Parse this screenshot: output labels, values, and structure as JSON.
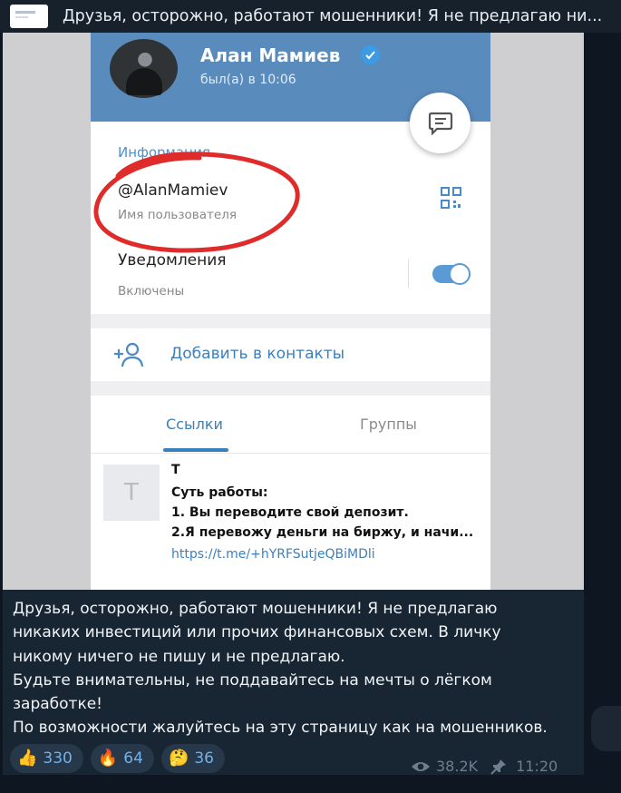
{
  "pinned": {
    "text": "Друзья, осторожно, работают мошенники! Я не предлагаю ни..."
  },
  "screenshot": {
    "profile_name": "Алан Мамиев",
    "last_seen": "был(а) в 10:06",
    "info_title": "Информация",
    "username": "@AlanMamiev",
    "username_label": "Имя пользователя",
    "notifications_title": "Уведомления",
    "notifications_state": "Включены",
    "add_contact": "Добавить в контакты",
    "tab_links": "Ссылки",
    "tab_groups": "Группы",
    "link_thumb_letter": "T",
    "link_title": "T",
    "link_line1": "Суть работы:",
    "link_line2": "1. Вы переводите свой депозит.",
    "link_line3": "2.Я перевожу деньги на биржу, и начи...",
    "link_url": "https://t.me/+hYRFSutjeQBiMDli"
  },
  "post": {
    "caption": [
      "Друзья, осторожно, работают мошенники! Я не предлагаю",
      "никаких инвестиций или прочих финансовых  схем. В личку",
      "никому ничего не пишу и не предлагаю.",
      "Будьте внимательны, не поддавайтесь на мечты о лёгком",
      "заработке!",
      "По возможности жалуйтесь на эту страницу как на мошенников."
    ],
    "reactions": [
      {
        "emoji": "👍",
        "count": "330"
      },
      {
        "emoji": "🔥",
        "count": "64"
      },
      {
        "emoji": "🤔",
        "count": "36"
      }
    ],
    "views": "38.2K",
    "time": "11:20"
  },
  "colors": {
    "background": "#0e1621",
    "card": "#182533",
    "accent": "#6fb2ee",
    "highlight_circle": "#e02b2b"
  },
  "icons": [
    "chat-icon",
    "qr-code-icon",
    "add-user-icon",
    "eye-icon",
    "pin-icon",
    "verified-icon"
  ]
}
